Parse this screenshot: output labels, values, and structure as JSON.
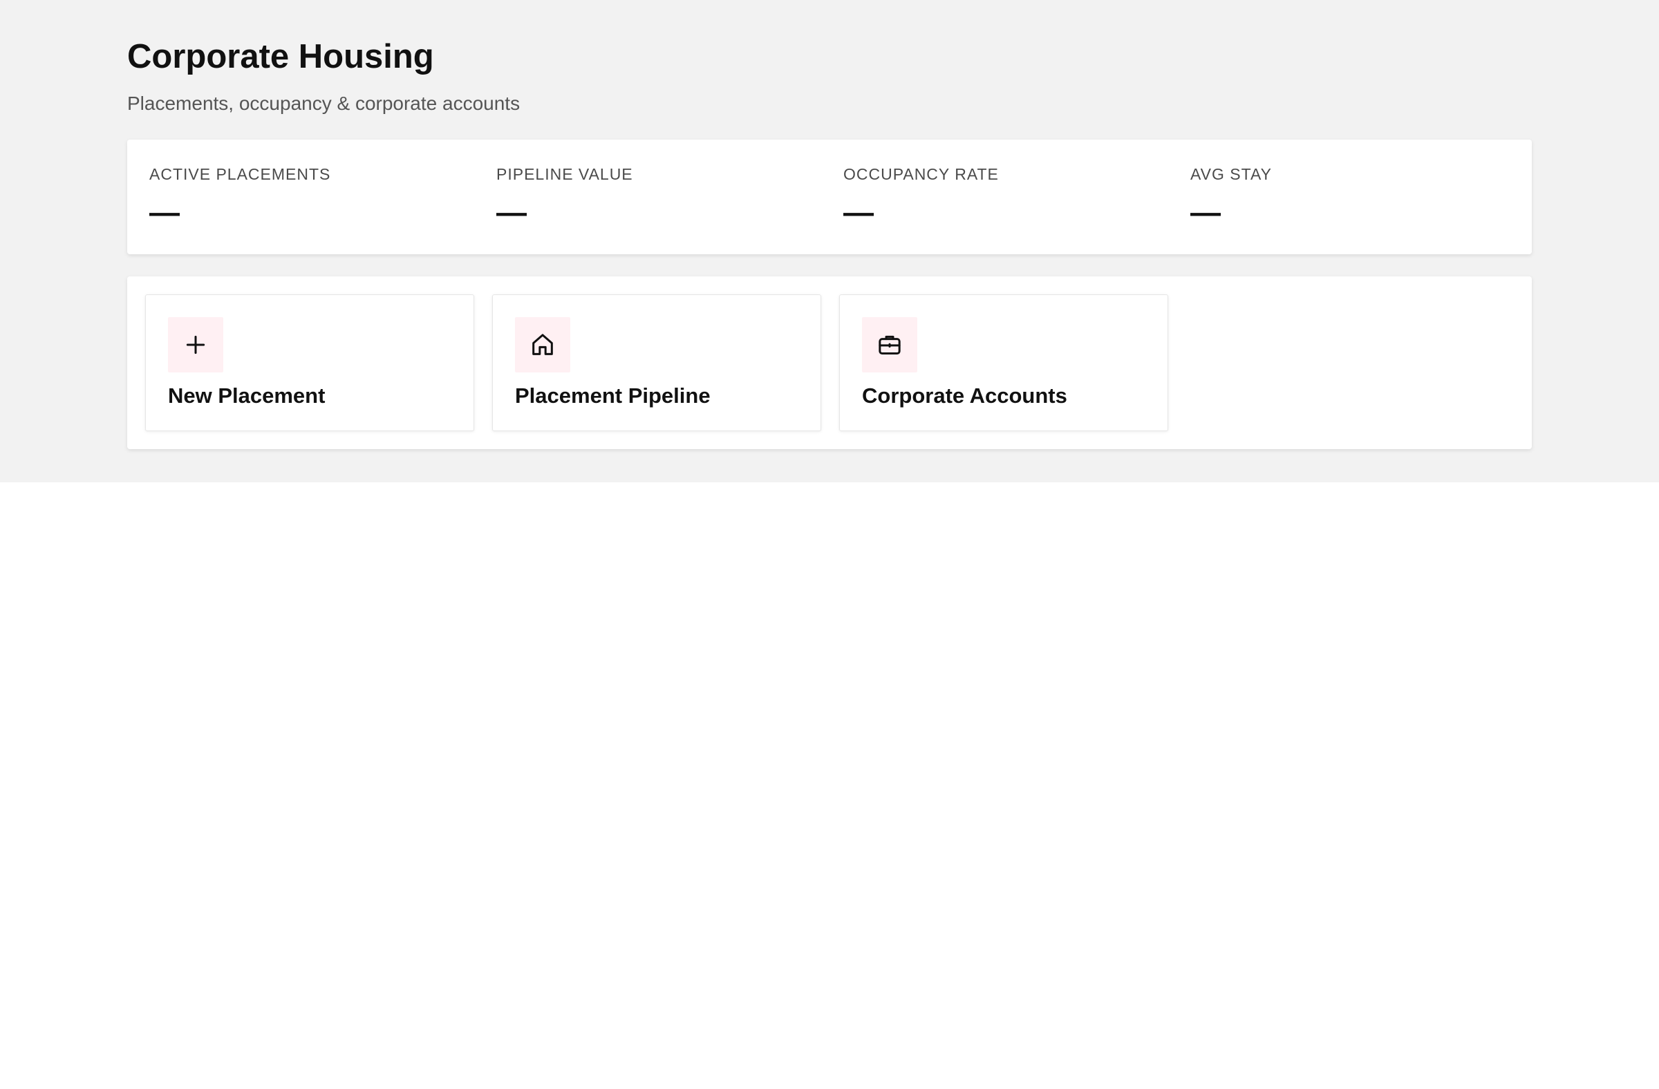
{
  "header": {
    "title": "Corporate Housing",
    "subtitle": "Placements, occupancy & corporate accounts"
  },
  "stats": [
    {
      "label": "ACTIVE PLACEMENTS",
      "value": "—"
    },
    {
      "label": "PIPELINE VALUE",
      "value": "—"
    },
    {
      "label": "OCCUPANCY RATE",
      "value": "—"
    },
    {
      "label": "AVG STAY",
      "value": "—"
    }
  ],
  "actions": [
    {
      "label": "New Placement",
      "icon": "plus-icon"
    },
    {
      "label": "Placement Pipeline",
      "icon": "house-icon"
    },
    {
      "label": "Corporate Accounts",
      "icon": "briefcase-icon"
    }
  ],
  "colors": {
    "background_top": "#f2f2f2",
    "card": "#ffffff",
    "icon_tile": "#fff0f3",
    "text_primary": "#111111",
    "text_secondary": "#555555"
  }
}
